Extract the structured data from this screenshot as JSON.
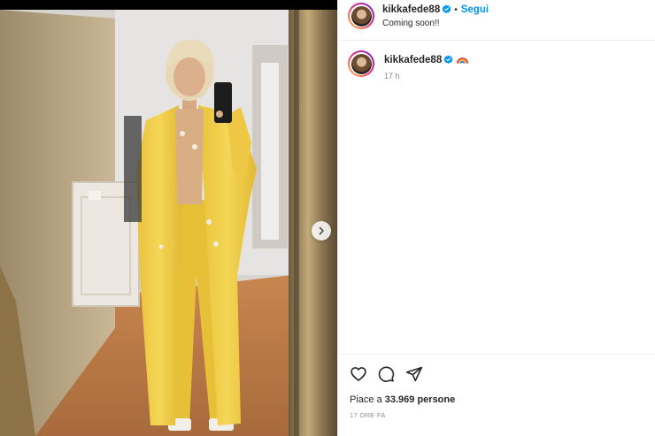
{
  "post": {
    "username": "kikkafede88",
    "follow_label": "Segui",
    "separator": "•",
    "location": "Coming soon!!",
    "caption_username": "kikkafede88",
    "caption_emoji": "rainbow",
    "caption_time": "17 h",
    "likes_prefix": "Piace a ",
    "likes_count": "33.969 persone",
    "date_label": "17 ORE FA"
  },
  "icons": {
    "verified": "verified-badge-icon",
    "like": "heart-icon",
    "comment": "comment-bubble-icon",
    "share": "paper-plane-icon",
    "next": "chevron-right-icon"
  },
  "colors": {
    "accent": "#0095f6",
    "text": "#262626",
    "secondary": "#8e8e8e",
    "border": "#efefef"
  }
}
